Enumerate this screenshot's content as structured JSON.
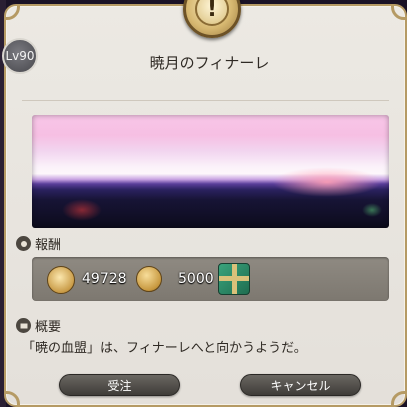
{
  "quest": {
    "level": "Lv90",
    "title": "暁月のフィナーレ"
  },
  "rewards": {
    "label": "報酬",
    "exp": "49728",
    "gil": "5000",
    "items": [
      "gift-box"
    ]
  },
  "summary": {
    "label": "概要",
    "text": "「暁の血盟」は、フィナーレへと向かうようだ。"
  },
  "buttons": {
    "accept": "受注",
    "cancel": "キャンセル"
  },
  "colors": {
    "frame": "#b59a64",
    "window": "#ece9e3",
    "button": "#4a4743"
  }
}
